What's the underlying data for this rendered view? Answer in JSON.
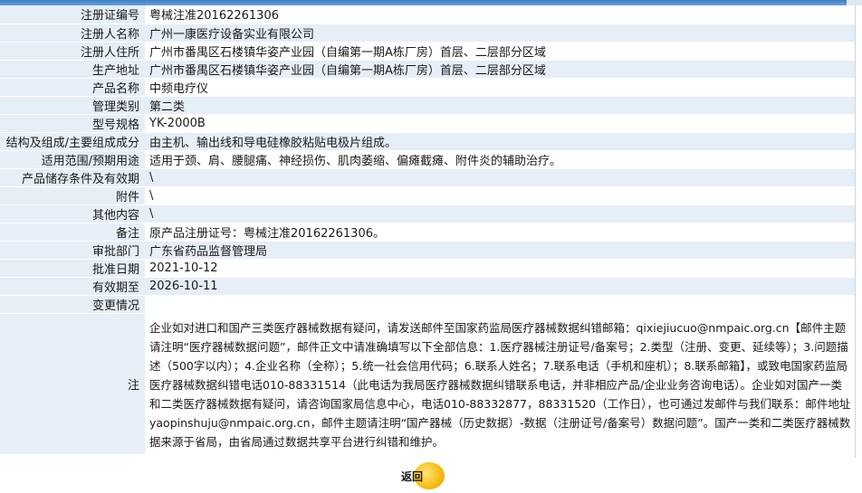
{
  "rows": [
    {
      "label": "注册证编号",
      "value": "粤械注准20162261306"
    },
    {
      "label": "注册人名称",
      "value": "广州一康医疗设备实业有限公司"
    },
    {
      "label": "注册人住所",
      "value": "广州市番禺区石楼镇华姿产业园（自编第一期A栋厂房）首层、二层部分区域"
    },
    {
      "label": "生产地址",
      "value": "广州市番禺区石楼镇华姿产业园（自编第一期A栋厂房）首层、二层部分区域"
    },
    {
      "label": "产品名称",
      "value": "中频电疗仪"
    },
    {
      "label": "管理类别",
      "value": "第二类"
    },
    {
      "label": "型号规格",
      "value": "YK-2000B"
    },
    {
      "label": "结构及组成/主要组成成分",
      "value": "由主机、输出线和导电硅橡胶粘贴电极片组成。"
    },
    {
      "label": "适用范围/预期用途",
      "value": "适用于颈、肩、腰腿痛、神经损伤、肌肉萎缩、偏瘫截瘫、附件炎的辅助治疗。"
    },
    {
      "label": "产品储存条件及有效期",
      "value": "\\"
    },
    {
      "label": "附件",
      "value": "\\"
    },
    {
      "label": "其他内容",
      "value": "\\"
    },
    {
      "label": "备注",
      "value": "原产品注册证号：粤械注准20162261306。"
    },
    {
      "label": "审批部门",
      "value": "广东省药品监督管理局"
    },
    {
      "label": "批准日期",
      "value": "2021-10-12"
    },
    {
      "label": "有效期至",
      "value": "2026-10-11"
    },
    {
      "label": "变更情况",
      "value": ""
    }
  ],
  "note": {
    "label": "注",
    "text": "企业如对进口和国产三类医疗器械数据有疑问，请发送邮件至国家药监局医疗器械数据纠错邮箱：qixiejiucuo@nmpaic.org.cn【邮件主题请注明“医疗器械数据问题”，邮件正文中请准确填写以下全部信息：1.医疗器械注册证号/备案号；2.类型（注册、变更、延续等）；3.问题描述（500字以内）；4.企业名称（全称）；5.统一社会信用代码；6.联系人姓名；7.联系电话（手机和座机）；8.联系邮箱】，或致电国家药监局医疗器械数据纠错电话010-88331514（此电话为我局医疗器械数据纠错联系电话，并非相应产品/企业业务咨询电话）。企业如对国产一类和二类医疗器械数据有疑问，请咨询国家局信息中心，电话010-88332877，88331520（工作日），也可通过发邮件与我们联系：邮件地址yaopinshuju@nmpaic.org.cn，邮件主题请注明“国产器械（历史数据）-数据（注册证号/备案号）数据问题”。国产一类和二类医疗器械数据来源于省局，由省局通过数据共享平台进行纠错和维护。"
  },
  "back_button": {
    "label": "返回"
  }
}
